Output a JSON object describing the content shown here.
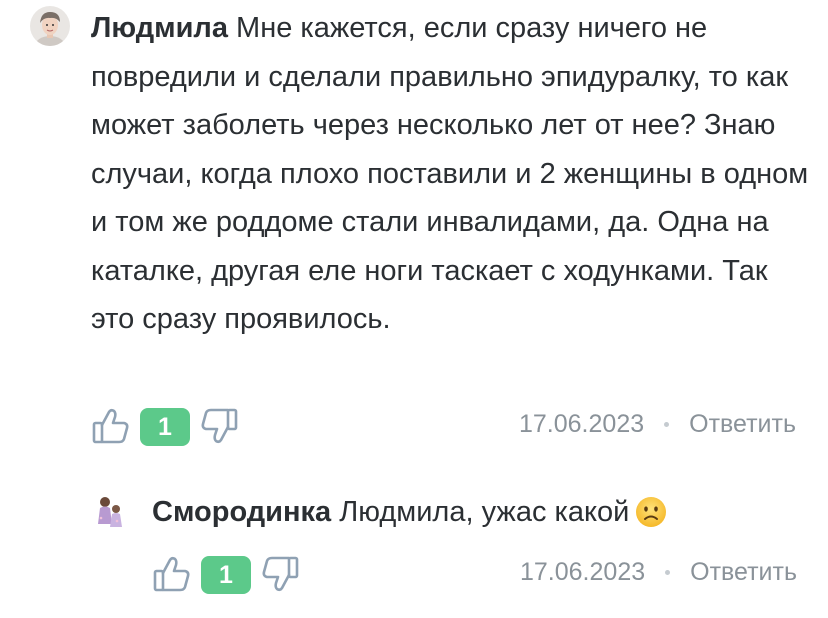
{
  "colors": {
    "text": "#2b2f33",
    "muted": "#8a9299",
    "like_badge": "#5cc98a",
    "icon_stroke": "#8fa1b3"
  },
  "comment": {
    "author": "Людмила",
    "text": " Мне кажется, если сразу ничего не повредили и сделали правильно эпидуралку, то как может заболеть через несколько лет от нее? Знаю случаи, когда плохо поставили и 2 женщины в одном и том же роддоме стали инвалидами, да. Одна на каталке, другая еле ноги таскает с ходунками. Так это сразу проявилось.",
    "likes": "1",
    "date": "17.06.2023",
    "reply_label": "Ответить",
    "avatar_icon": "user-avatar-photo",
    "like_icon": "thumbs-up-icon",
    "dislike_icon": "thumbs-down-icon"
  },
  "reply": {
    "author": "Смородинка",
    "text": " Людмила, ужас какой",
    "emoji": "slightly-frowning-face-emoji",
    "likes": "1",
    "date": "17.06.2023",
    "reply_label": "Ответить",
    "avatar_icon": "user-avatar-illustration"
  }
}
